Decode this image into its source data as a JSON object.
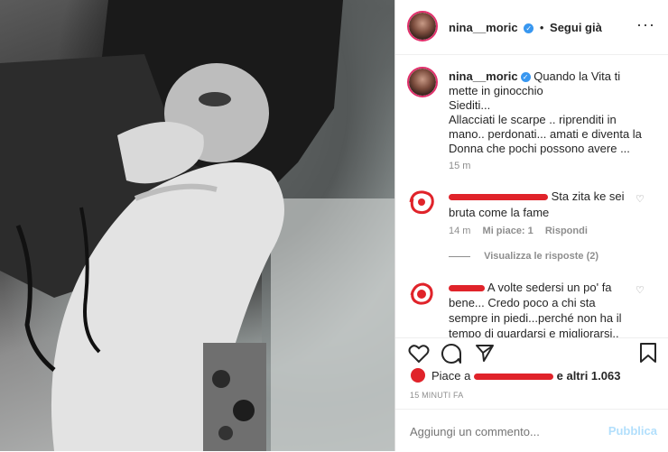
{
  "header": {
    "username": "nina__moric",
    "follow_label": "Segui già",
    "more_icon": "more-horizontal-icon"
  },
  "caption": {
    "username": "nina__moric",
    "lines": [
      "Quando la Vita ti",
      "mette in ginocchio",
      "Siediti...",
      "Allacciati le scarpe .. riprenditi in",
      "mano.. perdonati... amati e diventa la",
      "Donna che pochi possono avere ..."
    ],
    "time": "15 m"
  },
  "comments": [
    {
      "text_line1": "Sta zita ke sei",
      "text_line2": "bruta come la fame",
      "time": "14 m",
      "likes": "Mi piace: 1",
      "reply": "Rispondi",
      "view_replies": "Visualizza le risposte (2)"
    },
    {
      "text_line1": "A volte sedersi un po' fa",
      "text_line2": "bene... Credo poco a chi sta",
      "text_line3": "sempre in piedi...perché non ha il",
      "text_line4": "tempo di guardarsi e migliorarsi.."
    }
  ],
  "likes": {
    "prefix": "Piace a",
    "suffix": "e altri 1.063"
  },
  "timestamp": "15 MINUTI FA",
  "add_comment": {
    "placeholder": "Aggiungi un commento...",
    "publish_label": "Pubblica"
  },
  "colors": {
    "verified": "#3897f0",
    "publish_disabled": "#b2dffc",
    "redaction": "#e0232a"
  }
}
